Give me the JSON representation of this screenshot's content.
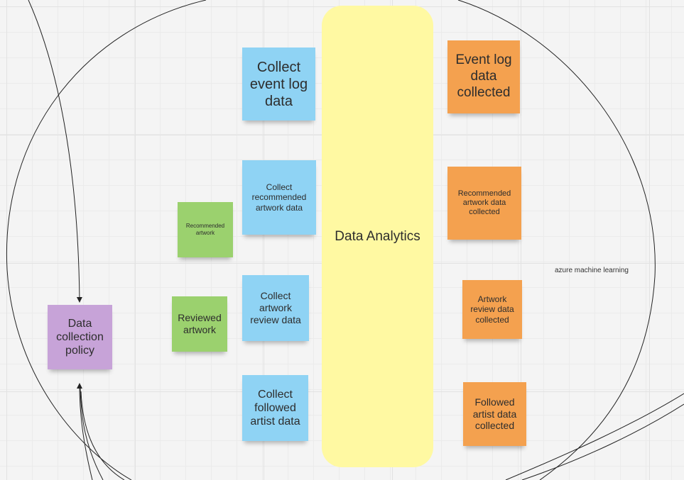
{
  "lane": {
    "label": "Data Analytics"
  },
  "stickies": {
    "collect_event_log": "Collect event log data",
    "collect_recommended": "Collect recommended artwork data",
    "collect_review": "Collect artwork review data",
    "collect_followed": "Collect followed artist data",
    "recommended_artwork": "Recommended artwork",
    "reviewed_artwork": "Reviewed artwork",
    "data_collection_policy": "Data collection policy",
    "event_log_collected": "Event log data collected",
    "recommended_collected": "Recommended artwork data collected",
    "review_collected": "Artwork review data collected",
    "followed_collected": "Followed artist data collected"
  },
  "labels": {
    "azure": "azure machine learning"
  },
  "colors": {
    "blue": "#8fd3f4",
    "green": "#9bd16e",
    "orange": "#f4a14f",
    "purple": "#c7a3d8",
    "yellow": "#fff9a2"
  }
}
